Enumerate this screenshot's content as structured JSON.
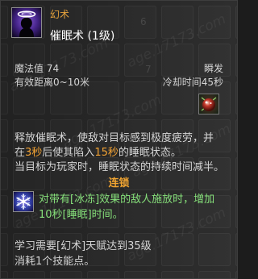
{
  "skill": {
    "icon": "hypnosis-head-icon",
    "school": "幻术",
    "name": "催眠术 (1级)"
  },
  "stats": {
    "mana_cost": "魔法值 74",
    "cast_time": "瞬发",
    "range": "有效距离0~10米",
    "cooldown": "冷却时间45秒"
  },
  "effect_icon": "red-orb-icon",
  "description": {
    "line1": "释放催眠术，使敌对目标感到极度疲劳，并",
    "line2": [
      {
        "text": "在",
        "highlight": false
      },
      {
        "text": "3秒",
        "highlight": true
      },
      {
        "text": "后使其陷入",
        "highlight": false
      },
      {
        "text": "15秒",
        "highlight": true
      },
      {
        "text": "的睡眠状态。",
        "highlight": false
      }
    ],
    "line3": "当目标为玩家时，睡眠状态的持续时间减半。"
  },
  "chain": {
    "heading": "连锁",
    "icon": "snowflake-icon",
    "line1": "对带有[冰冻]效果的敌人施放时，增加",
    "line2": "10秒[睡眠]时间。"
  },
  "requirements": {
    "line1": "学习需要[幻术]天赋达到35级",
    "line2": "消耗1个技能点。"
  },
  "background": {
    "slot_numbers": [
      "6",
      "7"
    ]
  },
  "watermark": "age.17173.com",
  "colors": {
    "background": "#2a2a2a",
    "school": "#e6a23c",
    "title": "#ffffff",
    "text": "#d4d4d4",
    "highlight": "#f2a233",
    "chain_heading": "#f0a431",
    "chain_text": "#86e07a"
  }
}
